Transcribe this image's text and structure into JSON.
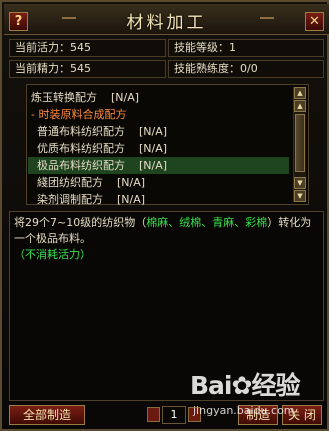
{
  "window": {
    "title": "材料加工",
    "help_label": "?",
    "close_label": "✕"
  },
  "stats": {
    "vitality": "当前活力：545",
    "skill_level": "技能等级：1",
    "energy": "当前精力：545",
    "proficiency": "技能熟练度：0/0"
  },
  "recipes": [
    {
      "label": "炼玉转换配方    [N/A]",
      "kind": "item",
      "selected": false
    },
    {
      "label": "- 时装原料合成配方",
      "kind": "category",
      "selected": false
    },
    {
      "label": "普通布料纺织配方    [N/A]",
      "kind": "item",
      "selected": false
    },
    {
      "label": "优质布料纺织配方    [N/A]",
      "kind": "item",
      "selected": false
    },
    {
      "label": "极品布料纺织配方    [N/A]",
      "kind": "item",
      "selected": true
    },
    {
      "label": "綫团纺织配方    [N/A]",
      "kind": "item",
      "selected": false
    },
    {
      "label": "染剂调制配方    [N/A]",
      "kind": "item",
      "selected": false
    }
  ],
  "scroll": {
    "up": "▲",
    "down": "▼",
    "top": "▲",
    "bottom": "▼"
  },
  "description": {
    "part1": "将29个7~10级的纺织物（",
    "materials": "棉麻、绒棉、青麻、彩棉",
    "part2": "）转化为一个极品布料。",
    "note": "（不消耗活力）"
  },
  "footer": {
    "make_all": "全部制造",
    "quantity": "1",
    "make": "制造",
    "close": "关 闭"
  },
  "watermark": {
    "text": "Bai✿经验",
    "sub": "jingyan.baidu.com"
  }
}
